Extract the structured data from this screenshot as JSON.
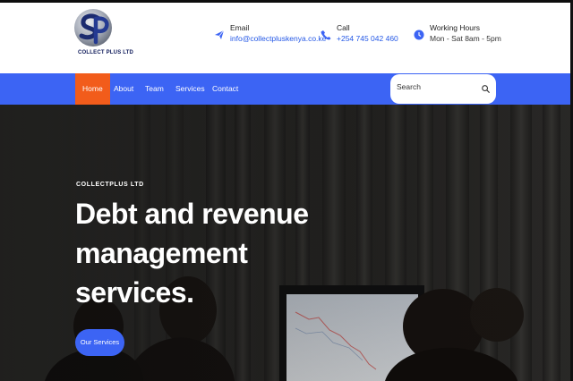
{
  "brand": {
    "name": "COLLECT PLUS LTD",
    "colors": {
      "primary": "#3c64f4",
      "active": "#f25c1b",
      "logo_navy": "#0e1a5a"
    }
  },
  "header": {
    "email": {
      "label": "Email",
      "value": "info@collectpluskenya.co.ke",
      "icon": "paper-plane-icon"
    },
    "call": {
      "label": "Call",
      "value": "+254 745 042 460",
      "icon": "phone-icon"
    },
    "hours": {
      "label": "Working Hours",
      "value": "Mon - Sat 8am - 5pm",
      "icon": "clock-icon"
    }
  },
  "nav": {
    "items": [
      {
        "label": "Home",
        "active": true
      },
      {
        "label": "About"
      },
      {
        "label": "Team"
      },
      {
        "label": "Services"
      },
      {
        "label": "Contact"
      }
    ],
    "search": {
      "placeholder": "Search",
      "icon": "search-icon"
    }
  },
  "hero": {
    "eyebrow": "COLLECTPLUS LTD",
    "headline": "Debt and revenue management services.",
    "cta_label": "Our Services"
  }
}
